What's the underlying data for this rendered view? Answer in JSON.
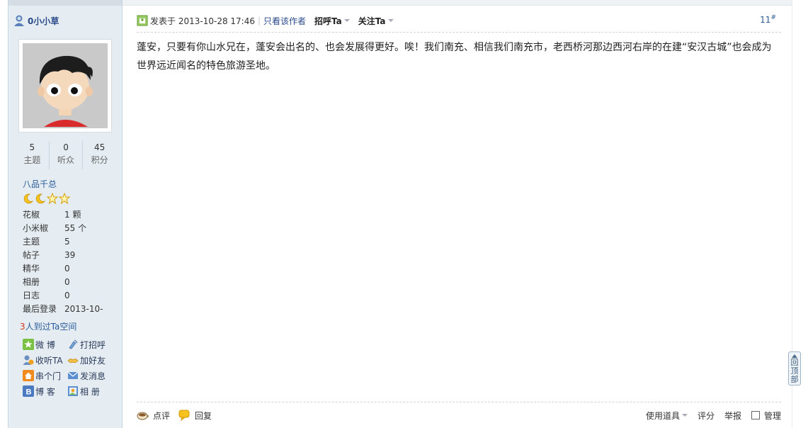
{
  "user": {
    "name": "0小小草",
    "stats": [
      {
        "num": "5",
        "label": "主题"
      },
      {
        "num": "0",
        "label": "听众"
      },
      {
        "num": "45",
        "label": "积分"
      }
    ],
    "rank": "八品千总",
    "rank_icons": [
      "moon-icon",
      "moon-icon",
      "star-icon",
      "star-icon"
    ],
    "info": [
      {
        "k": "花椒",
        "v": "1 颗"
      },
      {
        "k": "小米椒",
        "v": "55 个"
      },
      {
        "k": "主题",
        "v": "5"
      },
      {
        "k": "帖子",
        "v": "39"
      },
      {
        "k": "精华",
        "v": "0"
      },
      {
        "k": "相册",
        "v": "0"
      },
      {
        "k": "日志",
        "v": "0"
      },
      {
        "k": "最后登录",
        "v": "2013-10-"
      }
    ],
    "visited_count": "3",
    "visited_text": "人到过Ta空间",
    "actions": [
      {
        "label": "微 博",
        "icon": "weibo-icon"
      },
      {
        "label": "打招呼",
        "icon": "greet-icon"
      },
      {
        "label": "收听TA",
        "icon": "follow-icon"
      },
      {
        "label": "加好友",
        "icon": "add-friend-icon"
      },
      {
        "label": "串个门",
        "icon": "home-icon"
      },
      {
        "label": "发消息",
        "icon": "message-icon"
      },
      {
        "label": "博 客",
        "icon": "blog-icon"
      },
      {
        "label": "相 册",
        "icon": "album-icon"
      }
    ]
  },
  "post": {
    "posted_prefix": "发表于",
    "time": "2013-10-28 17:46",
    "separator": "|",
    "author_only": "只看该作者",
    "greet": "招呼Ta",
    "follow": "关注Ta",
    "floor_num": "11",
    "floor_mark": "#",
    "body": "蓬安，只要有你山水兄在，蓬安会出名的、也会发展得更好。唉！我们南充、相信我们南充市，老西桥河那边西河右岸的在建“安汉古城”也会成为世界远近闻名的特色旅游圣地。"
  },
  "footer": {
    "comment": "点评",
    "reply": "回复",
    "use_tool": "使用道具",
    "rate": "评分",
    "report": "举报",
    "manage": "管理"
  },
  "back_to_top": [
    "回",
    "顶",
    "部"
  ],
  "colors": {
    "sidebar_bg": "#e5edf2",
    "link_blue": "#2a5a9a",
    "visited_count_red": "#d23a1a"
  }
}
